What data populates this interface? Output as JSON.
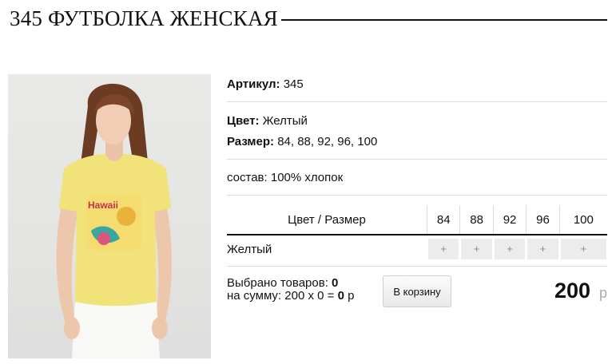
{
  "product": {
    "title": "345 ФУТБОЛКА ЖЕНСКАЯ",
    "article_label": "Артикул:",
    "article_value": "345",
    "color_label": "Цвет:",
    "color_value": "Желтый",
    "size_label": "Размер:",
    "size_value": "84, 88, 92, 96, 100",
    "composition": "состав: 100% хлопок"
  },
  "grid": {
    "header_label": "Цвет / Размер",
    "sizes": [
      "84",
      "88",
      "92",
      "96",
      "100"
    ],
    "rows": [
      {
        "color": "Желтый",
        "cells": [
          "+",
          "+",
          "+",
          "+",
          "+"
        ]
      }
    ]
  },
  "summary": {
    "selected_label": "Выбрано товаров:",
    "selected_count": "0",
    "sum_label": "на сумму: 200 х 0 =",
    "sum_value": "0",
    "sum_currency": "р",
    "cart_button": "В корзину",
    "total_price": "200",
    "total_currency": "р"
  },
  "colors": {
    "accent": "#111111",
    "shirt": "#f2e27a",
    "cell_bg": "#ececec"
  },
  "icons": [
    "product-photo"
  ]
}
